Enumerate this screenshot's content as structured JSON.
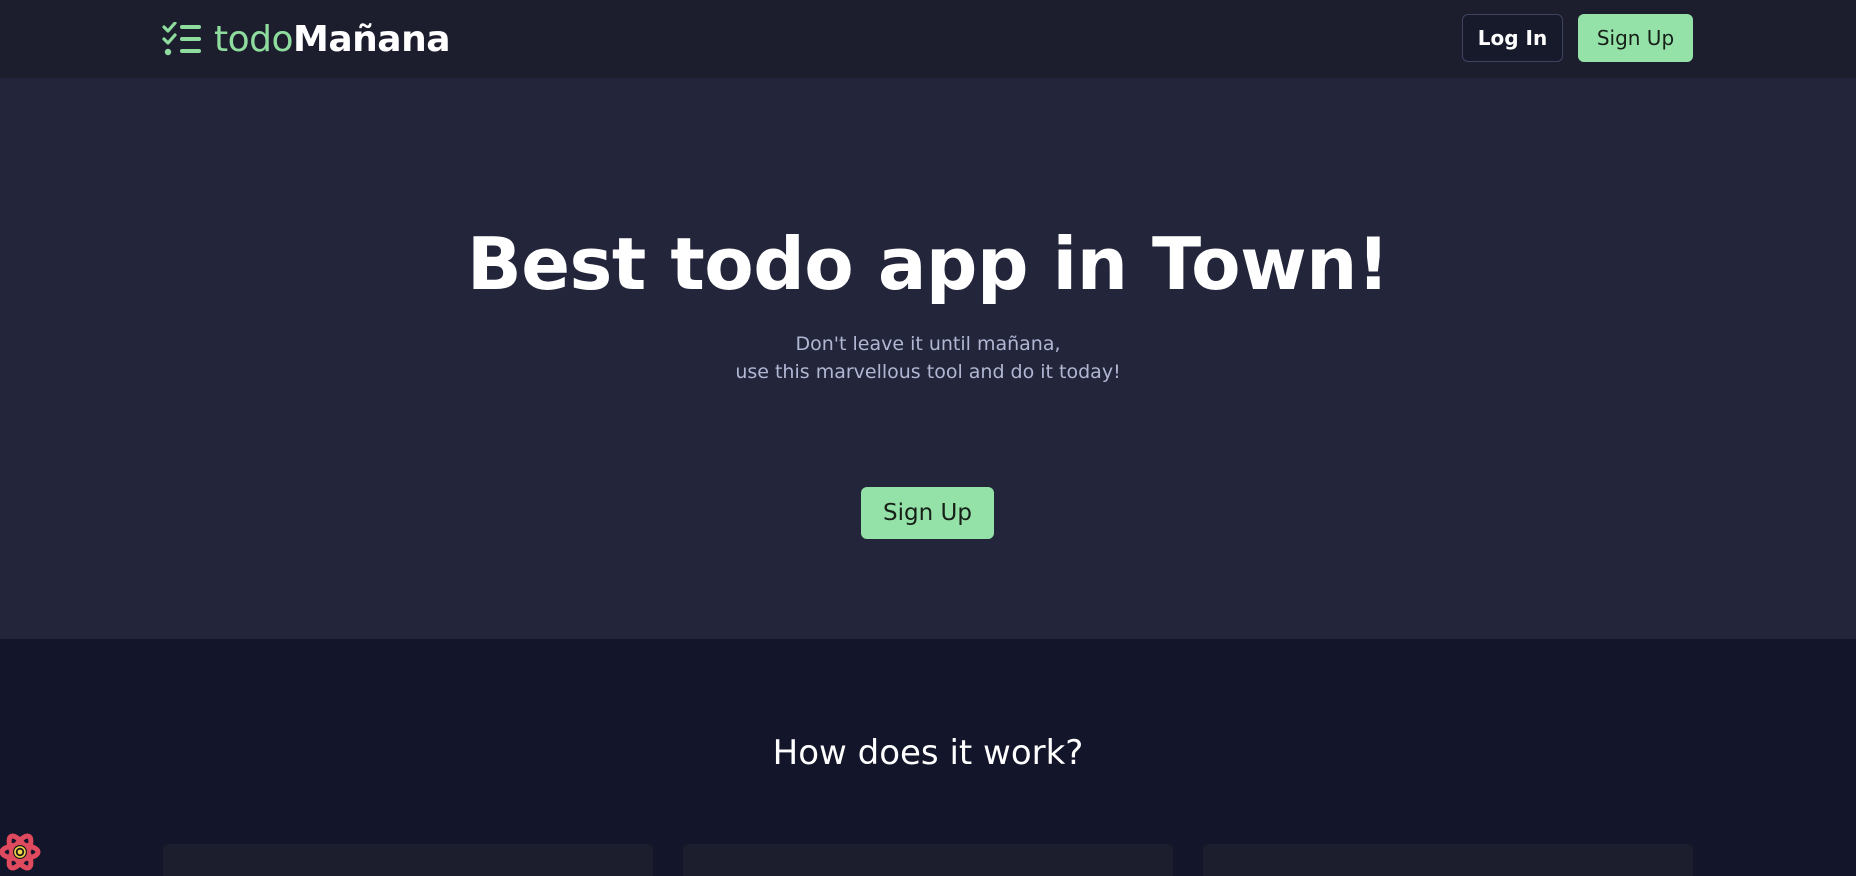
{
  "header": {
    "logo": {
      "part1": "todo",
      "part2": "Mañana",
      "icon": "checklist-icon"
    },
    "login_label": "Log In",
    "signup_label": "Sign Up"
  },
  "hero": {
    "title": "Best todo app in Town!",
    "subtitle_line1": "Don't leave it until mañana,",
    "subtitle_line2": "use this marvellous tool and do it today!",
    "cta_label": "Sign Up"
  },
  "how": {
    "title": "How does it work?"
  },
  "dev_badge": {
    "icon": "react-devtools-icon"
  },
  "colors": {
    "accent": "#95e2a8",
    "header_bg": "#1c1e2e",
    "hero_bg": "#23263b",
    "page_bg": "#13152a",
    "subtitle": "#b1b7d3"
  }
}
